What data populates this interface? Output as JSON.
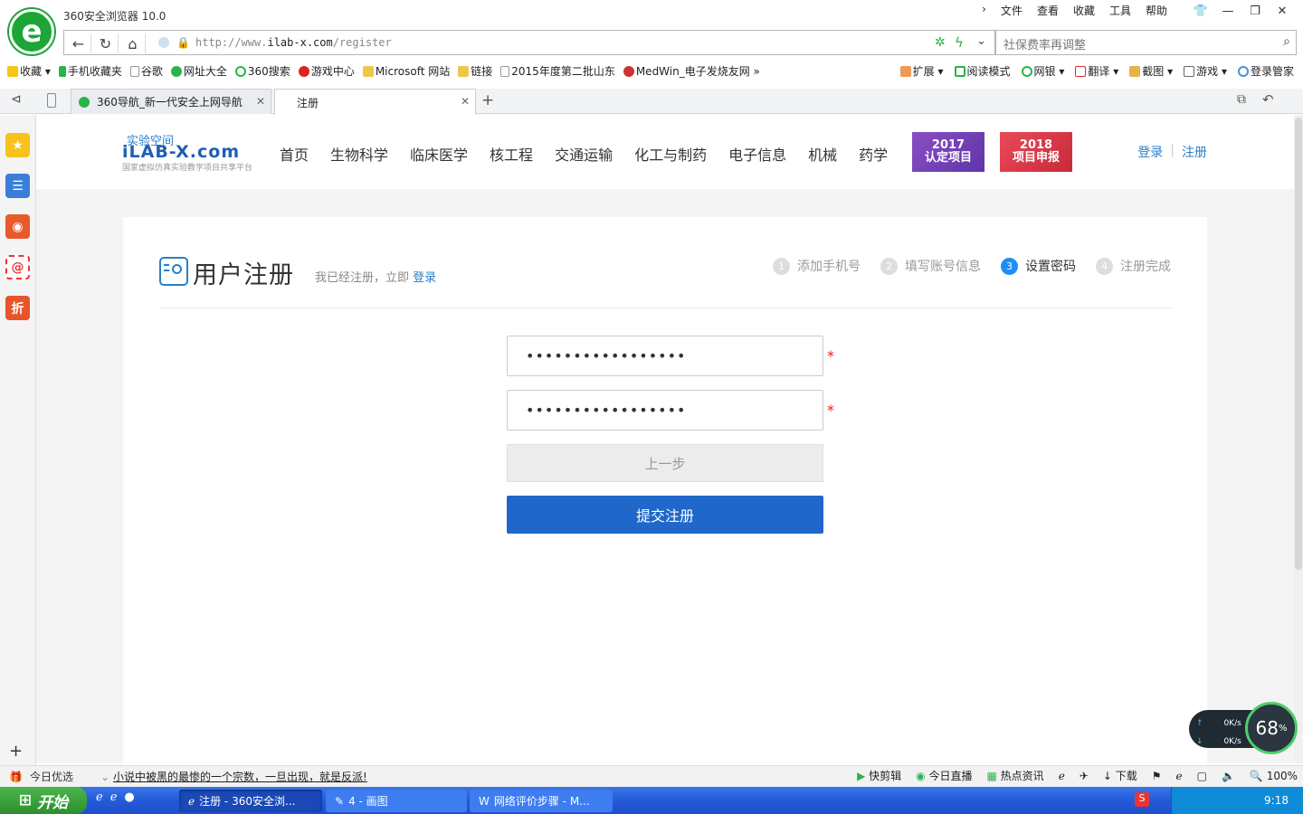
{
  "browser": {
    "title": "360安全浏览器 10.0",
    "menu": [
      "文件",
      "查看",
      "收藏",
      "工具",
      "帮助"
    ],
    "url_prefix": "http://www.",
    "url_domain": "ilab-x.com",
    "url_path": "/register",
    "search_value": "社保费率再调整",
    "bookmarks": [
      "收藏",
      "手机收藏夹",
      "谷歌",
      "网址大全",
      "360搜索",
      "游戏中心",
      "Microsoft 网站",
      "链接",
      "2015年度第二批山东",
      "MedWin_电子发烧友网"
    ],
    "extras": [
      "扩展",
      "阅读模式",
      "网银",
      "翻译",
      "截图",
      "游戏",
      "登录管家"
    ],
    "tabs": [
      {
        "label": "360导航_新一代安全上网导航"
      },
      {
        "label": "注册"
      }
    ],
    "status": {
      "today": "今日优选",
      "news": "小说中被黑的最惨的一个宗数，一旦出现，就是反派!",
      "items": [
        "快剪辑",
        "今日直播",
        "热点资讯",
        "下载",
        "100%"
      ]
    },
    "speed": {
      "up": "0K/s",
      "down": "0K/s",
      "percent": "68"
    }
  },
  "site": {
    "logo_top": "实验空间",
    "logo_main": "iLAB-X.com",
    "logo_sub": "国家虚拟仿真实验教学项目共享平台",
    "nav": [
      "首页",
      "生物科学",
      "临床医学",
      "核工程",
      "交通运输",
      "化工与制药",
      "电子信息",
      "机械",
      "药学"
    ],
    "promo1": {
      "year": "2017",
      "text": "认定项目"
    },
    "promo2": {
      "year": "2018",
      "text": "项目申报"
    },
    "login": "登录",
    "register": "注册"
  },
  "register": {
    "title": "用户注册",
    "already": "我已经注册，立即",
    "login_link": "登录",
    "steps": [
      {
        "num": "1",
        "label": "添加手机号"
      },
      {
        "num": "2",
        "label": "填写账号信息"
      },
      {
        "num": "3",
        "label": "设置密码"
      },
      {
        "num": "4",
        "label": "注册完成"
      }
    ],
    "active_step": 3,
    "password_value": "•••••••••••••••••",
    "confirm_value": "•••••••••••••••••",
    "required_mark": "*",
    "prev_label": "上一步",
    "submit_label": "提交注册"
  },
  "taskbar": {
    "start": "开始",
    "windows": [
      "注册 - 360安全浏...",
      "4 - 画图",
      "网络评价步骤 - M..."
    ],
    "clock": "9:18"
  }
}
